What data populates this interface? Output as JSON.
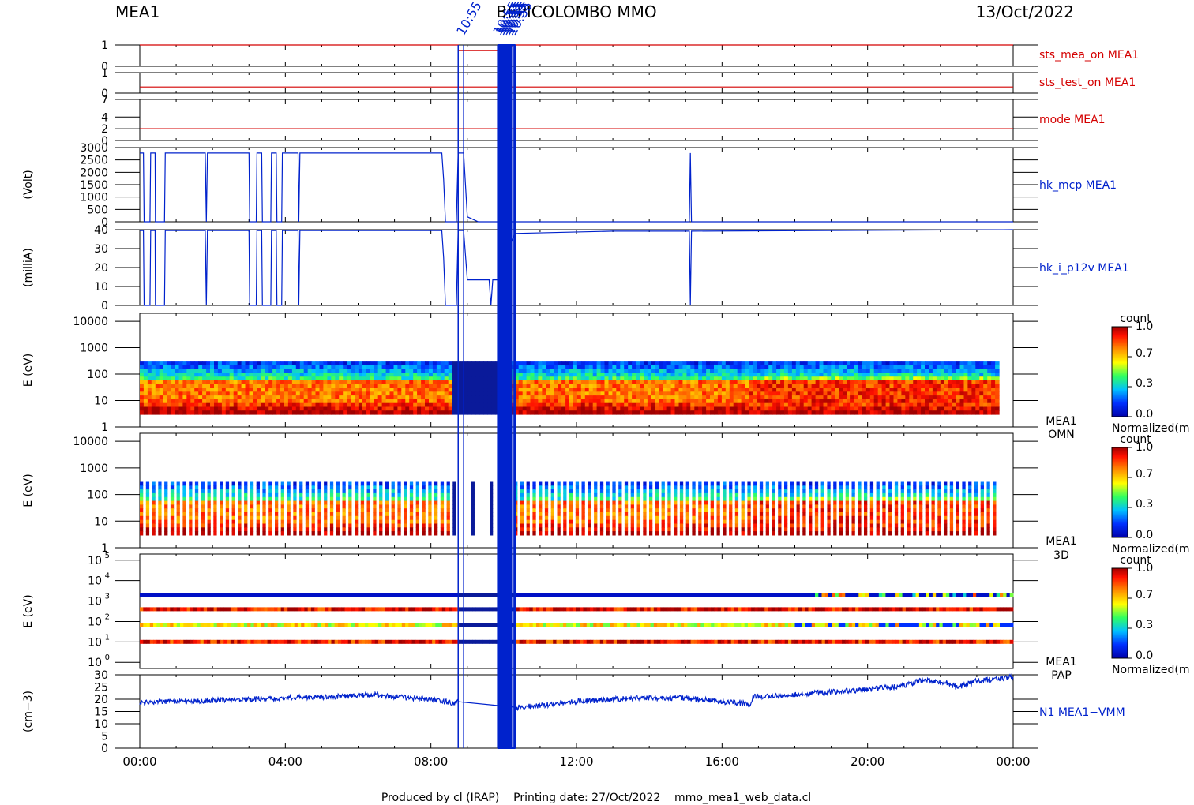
{
  "header": {
    "left": "MEA1",
    "center": "BEPICOLOMBO MMO",
    "right": "13/Oct/2022"
  },
  "footer": "Produced by cl (IRAP)    Printing date: 27/Oct/2022    mmo_mea1_web_data.cl",
  "colors": {
    "red": "#d40000",
    "blue": "#0022cc",
    "axis": "#000000"
  },
  "time_axis": {
    "ticks": [
      "00:00",
      "04:00",
      "08:00",
      "12:00",
      "16:00",
      "20:00",
      "00:00"
    ],
    "range_hours": [
      0,
      24
    ]
  },
  "event_lines": {
    "hours": [
      8.75,
      8.9,
      9.85,
      9.9,
      9.95,
      10.0,
      10.05,
      10.1,
      10.15,
      10.2,
      10.3
    ],
    "labels": [
      "10:55"
    ]
  },
  "colorbar": {
    "title": "count",
    "ticks": [
      "1.0",
      "0.7",
      "0.3",
      "0.0"
    ],
    "label": "Normalized(m"
  },
  "chart_data": [
    {
      "type": "line",
      "name": "sts_mea_on",
      "label": "sts_mea_on MEA1",
      "color": "red",
      "ylim": [
        0,
        1
      ],
      "yticks": [
        "1",
        "0"
      ],
      "points": [
        [
          0,
          1
        ],
        [
          8.75,
          1
        ],
        [
          8.75,
          0.75
        ],
        [
          9.85,
          0.75
        ],
        [
          10.3,
          1
        ],
        [
          24,
          1
        ]
      ]
    },
    {
      "type": "line",
      "name": "sts_test_on",
      "label": "sts_test_on MEA1",
      "color": "red",
      "ylim": [
        0,
        1
      ],
      "yticks": [
        "1",
        "0"
      ],
      "points": [
        [
          0,
          0.3
        ],
        [
          24,
          0.3
        ]
      ]
    },
    {
      "type": "line",
      "name": "mode",
      "label": "mode MEA1",
      "color": "red",
      "ylim": [
        0,
        7
      ],
      "yticks": [
        "7",
        "4",
        "2",
        "0"
      ],
      "points": [
        [
          0,
          2
        ],
        [
          24,
          2
        ]
      ]
    },
    {
      "type": "line",
      "name": "hk_mcp",
      "label": "hk_mcp MEA1",
      "ylabel": "(Volt)",
      "color": "blue",
      "ylim": [
        0,
        3000
      ],
      "yticks": [
        "3000",
        "2500",
        "2000",
        "1500",
        "1000",
        "500",
        "0"
      ],
      "points": [
        [
          0,
          2780
        ],
        [
          0.1,
          2780
        ],
        [
          0.12,
          0
        ],
        [
          0.28,
          0
        ],
        [
          0.3,
          2780
        ],
        [
          0.42,
          2780
        ],
        [
          0.43,
          0
        ],
        [
          0.68,
          0
        ],
        [
          0.7,
          2780
        ],
        [
          1.8,
          2780
        ],
        [
          1.83,
          0
        ],
        [
          1.86,
          2780
        ],
        [
          3,
          2780
        ],
        [
          3.02,
          0
        ],
        [
          3.2,
          0
        ],
        [
          3.22,
          2780
        ],
        [
          3.35,
          2780
        ],
        [
          3.37,
          0
        ],
        [
          3.6,
          0
        ],
        [
          3.62,
          2780
        ],
        [
          3.75,
          2780
        ],
        [
          3.77,
          0
        ],
        [
          3.9,
          0
        ],
        [
          3.92,
          2780
        ],
        [
          4.35,
          2780
        ],
        [
          4.37,
          0
        ],
        [
          4.4,
          2780
        ],
        [
          8.3,
          2780
        ],
        [
          8.35,
          1700
        ],
        [
          8.4,
          0
        ],
        [
          8.7,
          0
        ],
        [
          8.75,
          2780
        ],
        [
          8.9,
          2780
        ],
        [
          9.0,
          200
        ],
        [
          9.3,
          0
        ],
        [
          9.85,
          0
        ],
        [
          10.3,
          0
        ],
        [
          15.1,
          0
        ],
        [
          15.13,
          2780
        ],
        [
          15.16,
          0
        ],
        [
          24,
          0
        ]
      ],
      "baseline": 0
    },
    {
      "type": "line",
      "name": "hk_i_p12v",
      "label": "hk_i_p12v MEA1",
      "ylabel": "(milliA)",
      "color": "blue",
      "ylim": [
        0,
        40
      ],
      "yticks": [
        "40",
        "30",
        "20",
        "10",
        "0"
      ],
      "points": [
        [
          0,
          39.5
        ],
        [
          0.1,
          39.5
        ],
        [
          0.12,
          0
        ],
        [
          0.28,
          0
        ],
        [
          0.3,
          39.5
        ],
        [
          0.42,
          39.5
        ],
        [
          0.43,
          0
        ],
        [
          0.68,
          0
        ],
        [
          0.7,
          39.5
        ],
        [
          1.8,
          39.5
        ],
        [
          1.83,
          0
        ],
        [
          1.86,
          39.5
        ],
        [
          3,
          39.5
        ],
        [
          3.02,
          0
        ],
        [
          3.2,
          0
        ],
        [
          3.22,
          39.5
        ],
        [
          3.35,
          39.5
        ],
        [
          3.37,
          0
        ],
        [
          3.6,
          0
        ],
        [
          3.62,
          39.5
        ],
        [
          3.75,
          39.5
        ],
        [
          3.77,
          0
        ],
        [
          3.9,
          0
        ],
        [
          3.92,
          39.5
        ],
        [
          4.35,
          39.5
        ],
        [
          4.37,
          0
        ],
        [
          4.4,
          39.5
        ],
        [
          8.3,
          39.5
        ],
        [
          8.35,
          25
        ],
        [
          8.4,
          0
        ],
        [
          8.7,
          0
        ],
        [
          8.75,
          39.5
        ],
        [
          8.9,
          39.5
        ],
        [
          9.0,
          13.5
        ],
        [
          9.6,
          13.5
        ],
        [
          9.65,
          0
        ],
        [
          9.7,
          13.5
        ],
        [
          9.85,
          13.5
        ],
        [
          10.3,
          38
        ],
        [
          13,
          39.2
        ],
        [
          15.1,
          39.2
        ],
        [
          15.13,
          0
        ],
        [
          15.16,
          39.2
        ],
        [
          24,
          40
        ]
      ],
      "baseline": 0
    },
    {
      "type": "heatmap",
      "name": "MEA1 OMN",
      "label": "MEA1",
      "sublabel": "OMN",
      "ylabel": "E (eV)",
      "ylog": true,
      "ylim": [
        1,
        20000
      ],
      "yticks": [
        "10000",
        "1000",
        "100",
        "10",
        "1"
      ],
      "energy_range_eV": [
        3,
        300
      ]
    },
    {
      "type": "heatmap",
      "name": "MEA1 3D",
      "label": "MEA1",
      "sublabel": "3D",
      "ylabel": "E (eV)",
      "ylog": true,
      "ylim": [
        1,
        20000
      ],
      "yticks": [
        "10000",
        "1000",
        "100",
        "10",
        "1"
      ],
      "energy_range_eV": [
        3,
        300
      ]
    },
    {
      "type": "heatmap",
      "name": "MEA1 PAP",
      "label": "MEA1",
      "sublabel": "PAP",
      "ylabel": "E (eV)",
      "ylog": true,
      "ylim": [
        0.5,
        200000
      ],
      "yticks": [
        "10^5",
        "10^4",
        "10^3",
        "10^2",
        "10^1",
        "10^0"
      ],
      "bands_eV": [
        2000,
        400,
        70,
        10
      ]
    },
    {
      "type": "line",
      "name": "N1 MEA1-VMM",
      "label": "N1  MEA1−VMM",
      "ylabel": "(cm−3)",
      "color": "blue",
      "ylim": [
        0,
        30
      ],
      "yticks": [
        "30",
        "25",
        "20",
        "15",
        "10",
        "5",
        "0"
      ],
      "points": [
        [
          0,
          18.5
        ],
        [
          1,
          19
        ],
        [
          2,
          19.5
        ],
        [
          3,
          20
        ],
        [
          4,
          20.5
        ],
        [
          5,
          21
        ],
        [
          6,
          21.5
        ],
        [
          6.5,
          22
        ],
        [
          7,
          21
        ],
        [
          8,
          20
        ],
        [
          8.6,
          18.5
        ],
        [
          8.75,
          19
        ],
        [
          10.3,
          16.5
        ],
        [
          11,
          17.5
        ],
        [
          12,
          19
        ],
        [
          13,
          20
        ],
        [
          14,
          20.5
        ],
        [
          15,
          20.5
        ],
        [
          16,
          19
        ],
        [
          16.8,
          18
        ],
        [
          16.85,
          21
        ],
        [
          18,
          22
        ],
        [
          19,
          23
        ],
        [
          20,
          24
        ],
        [
          21,
          25.5
        ],
        [
          21.5,
          28
        ],
        [
          22,
          27
        ],
        [
          22.5,
          25
        ],
        [
          23,
          27.5
        ],
        [
          24,
          29
        ]
      ]
    }
  ]
}
